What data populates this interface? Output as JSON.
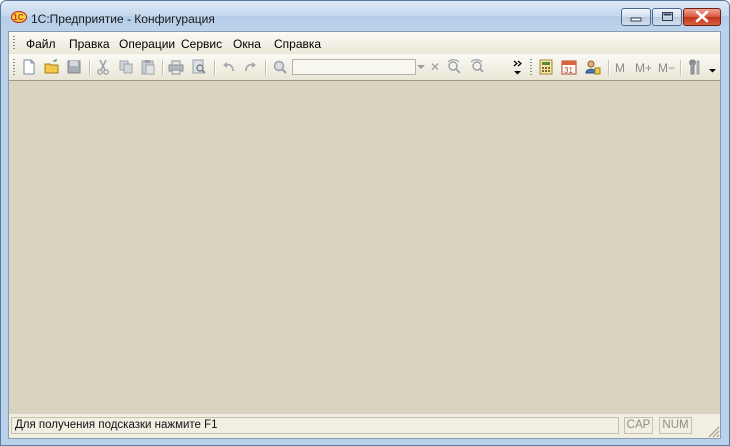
{
  "window": {
    "title": "1С:Предприятие - Конфигурация",
    "app_icon": "1c-logo-icon"
  },
  "menu": {
    "items": [
      {
        "label": "Файл"
      },
      {
        "label": "Правка"
      },
      {
        "label": "Операции"
      },
      {
        "label": "Сервис"
      },
      {
        "label": "Окна"
      },
      {
        "label": "Справка"
      }
    ]
  },
  "toolbar": {
    "icons": [
      "new-document-icon",
      "open-folder-icon",
      "save-icon",
      "cut-icon",
      "copy-icon",
      "paste-icon",
      "print-icon",
      "print-preview-icon",
      "undo-icon",
      "redo-icon",
      "find-icon",
      "find-next-icon",
      "find-previous-icon",
      "chevron-more-icon",
      "calculator-icon",
      "calendar-icon",
      "users-icon",
      "tools-icon",
      "dropdown-arrow-icon"
    ],
    "search_value": "",
    "memory_buttons": [
      "M",
      "M+",
      "M−"
    ],
    "calendar_day": "31"
  },
  "status": {
    "hint": "Для получения подсказки нажмите F1",
    "cap": "CAP",
    "num": "NUM"
  },
  "colors": {
    "workspace": "#d8d4c0",
    "frame": "#b9d1ea",
    "close_button": "#c2331b"
  }
}
